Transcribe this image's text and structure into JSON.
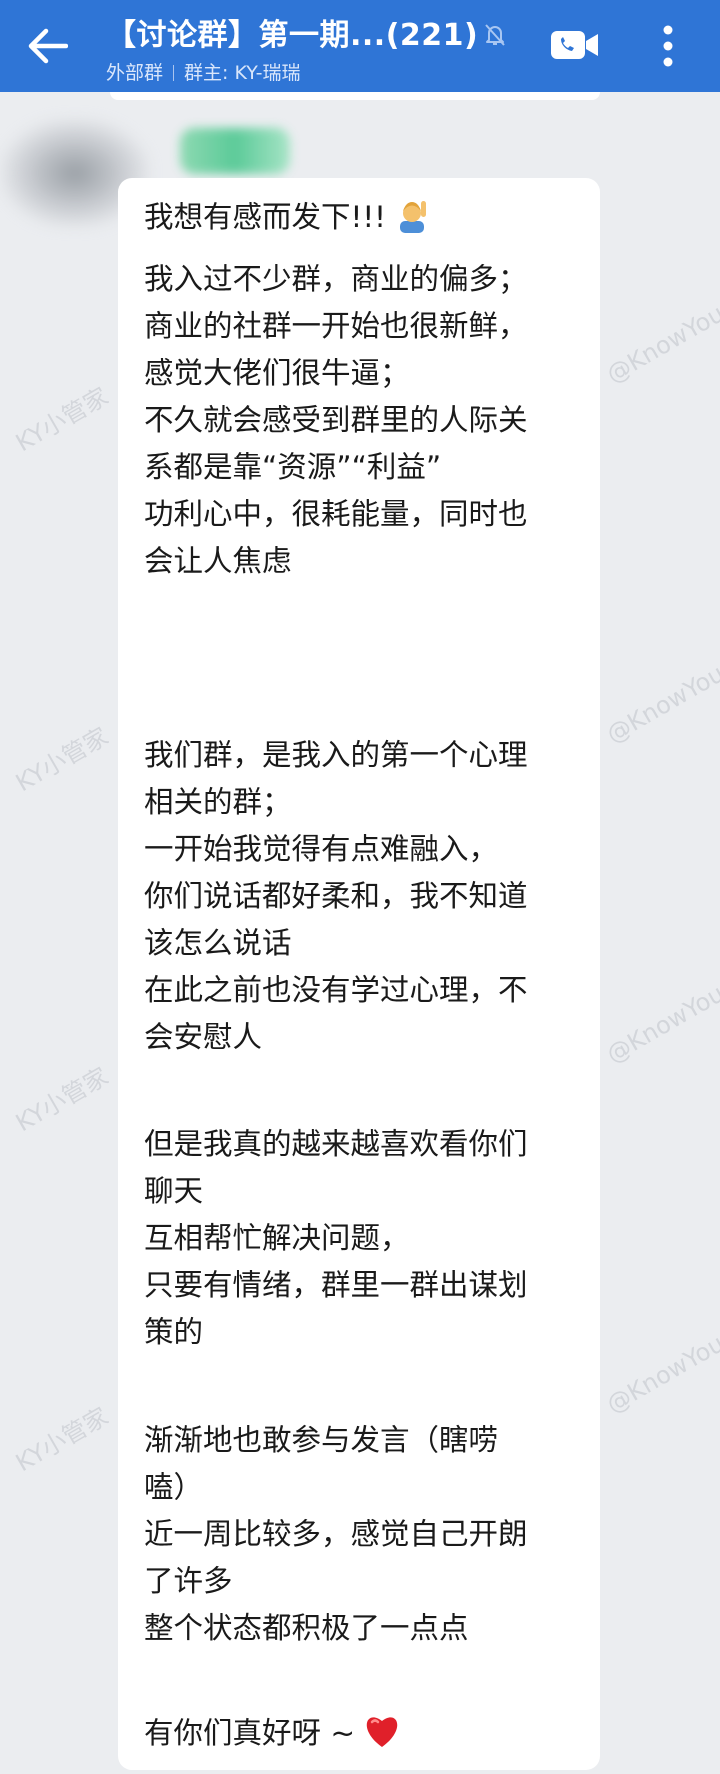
{
  "header": {
    "title": "【讨论群】第一期...(221)",
    "tag": "外部群",
    "owner": "群主: KY-瑞瑞",
    "icons": [
      "back-arrow-icon",
      "mute-icon",
      "video-call-icon",
      "more-icon"
    ],
    "colors": {
      "bar": "#2f75d6",
      "background": "#ebedf0",
      "bubble": "#ffffff"
    }
  },
  "message": {
    "lines": [
      "我想有感而发下!!!",
      "",
      "我入过不少群，商业的偏多；",
      "商业的社群一开始也很新鲜，",
      "感觉大佬们很牛逼；",
      "不久就会感受到群里的人际关",
      "系都是靠“资源”“利益”",
      "功利心中，很耗能量，同时也",
      "会让人焦虑",
      "",
      "",
      "我们群，是我入的第一个心理",
      "相关的群；",
      "一开始我觉得有点难融入，",
      "你们说话都好柔和，我不知道",
      "该怎么说话",
      "在此之前也没有学过心理，不",
      "会安慰人",
      "",
      "但是我真的越来越喜欢看你们",
      "聊天",
      "互相帮忙解决问题，",
      "只要有情绪，群里一群出谋划",
      "策的",
      "",
      "渐渐地也敢参与发言（瞎唠",
      "嗑）",
      "近一周比较多，感觉自己开朗",
      "了许多",
      "整个状态都积极了一点点",
      "",
      "有你们真好呀 ~"
    ],
    "emojis": [
      "person-raising-hand-icon",
      "red-heart-icon"
    ]
  },
  "watermark": {
    "texts": [
      "KY小管家",
      "@KnowYou"
    ]
  }
}
